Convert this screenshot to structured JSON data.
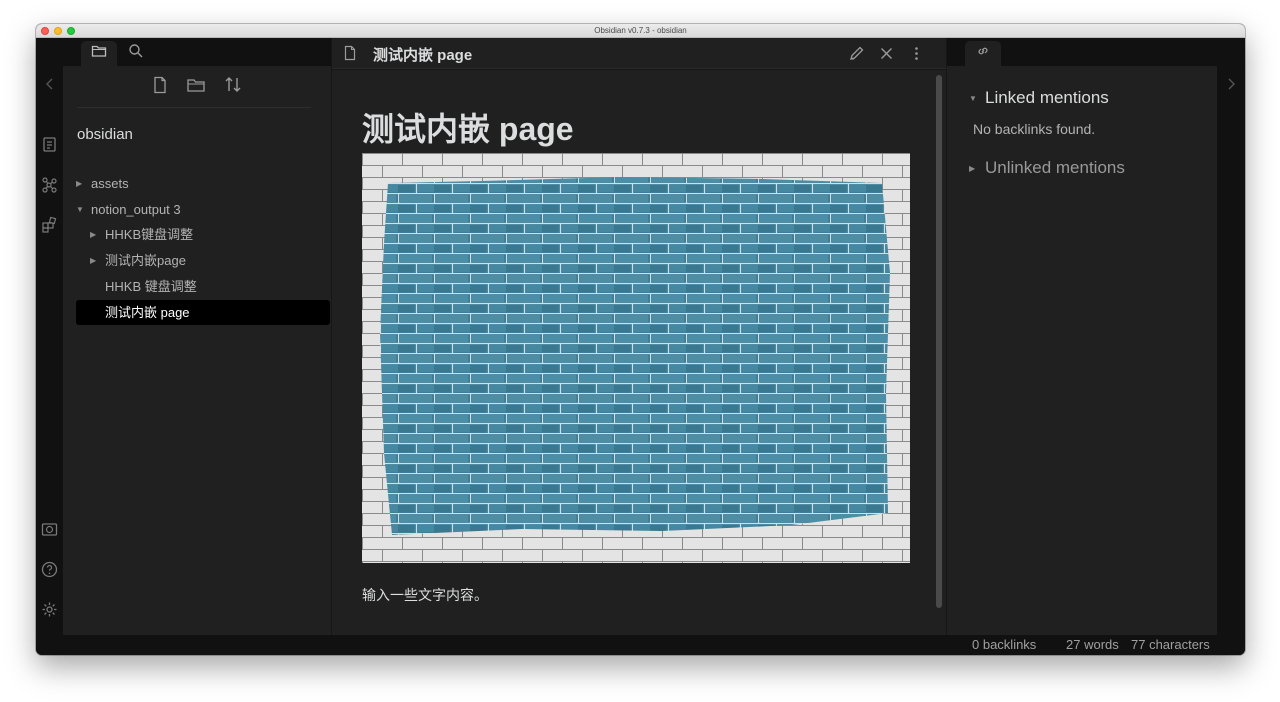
{
  "window": {
    "title": "Obsidian v0.7.3 - obsidian"
  },
  "ribbon": {
    "icons": [
      "open-file-icon",
      "graph-view-icon",
      "plugins-icon",
      "vault-icon",
      "help-icon",
      "settings-icon"
    ]
  },
  "left_sidebar": {
    "tabs": [
      "folder-icon",
      "search-icon"
    ],
    "actions": [
      "new-note-icon",
      "new-folder-icon",
      "sort-icon"
    ],
    "vault_name": "obsidian",
    "tree": [
      {
        "label": "assets",
        "type": "folder",
        "expanded": false,
        "depth": 0
      },
      {
        "label": "notion_output 3",
        "type": "folder",
        "expanded": true,
        "depth": 0
      },
      {
        "label": "HHKB键盘调整",
        "type": "folder",
        "expanded": false,
        "depth": 1
      },
      {
        "label": "测试内嵌page",
        "type": "folder",
        "expanded": false,
        "depth": 1
      },
      {
        "label": "HHKB 键盘调整",
        "type": "file",
        "depth": 1
      },
      {
        "label": "测试内嵌 page",
        "type": "file",
        "depth": 1,
        "active": true
      }
    ]
  },
  "editor": {
    "tab_title": "测试内嵌 page",
    "heading": "测试内嵌 page",
    "image": "brick-wall-painted-blue",
    "paragraph": "输入一些文字内容。",
    "actions": [
      "edit-icon",
      "close-icon",
      "more-options-icon"
    ]
  },
  "right_sidebar": {
    "tab": "link-icon",
    "linked_mentions": "Linked mentions",
    "no_backlinks": "No backlinks found.",
    "unlinked_mentions": "Unlinked mentions"
  },
  "status_bar": {
    "backlinks": "0 backlinks",
    "words": "27 words",
    "characters": "77 characters"
  },
  "colors": {
    "background": "#161616",
    "panel": "#202020",
    "text": "#dcddde",
    "brick_blue": "#3e7f97"
  }
}
